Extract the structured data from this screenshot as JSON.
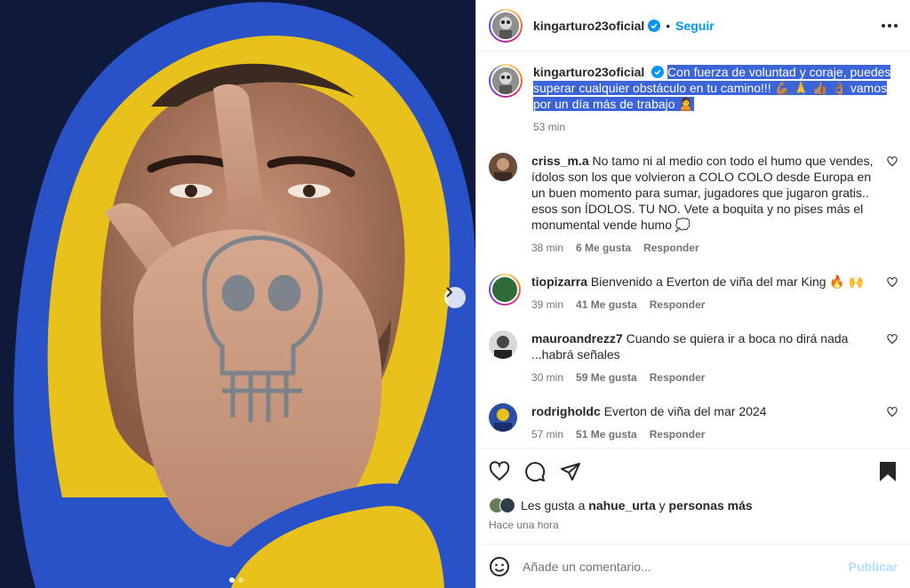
{
  "post": {
    "username": "kingarturo23oficial",
    "follow_label": "Seguir",
    "separator": "•",
    "caption": "Con fuerza de voluntad y coraje, puedes superar cualquier obstáculo en tu camino!!! 💪🏽 🙏 👍🏽 👌🏽 vamos por un día más de trabajo 🙎",
    "caption_time": "53 min"
  },
  "comments": [
    {
      "username": "criss_m.a",
      "text": "No tamo ni al medio con todo el humo que vendes, ídolos son los que volvieron a COLO COLO desde Europa en un buen momento para sumar, jugadores que jugaron gratis.. esos son ÍDOLOS. TU NO. Vete a boquita y no pises más el monumental vende humo 💭",
      "time": "38 min",
      "likes": "6 Me gusta",
      "reply": "Responder"
    },
    {
      "username": "tiopizarra",
      "text": "Bienvenido a Everton de viña del mar King 🔥 🙌",
      "time": "39 min",
      "likes": "41 Me gusta",
      "reply": "Responder"
    },
    {
      "username": "mauroandrezz7",
      "text": "Cuando se quiera ir a boca no dirá nada ...habrá señales",
      "time": "30 min",
      "likes": "59 Me gusta",
      "reply": "Responder"
    },
    {
      "username": "rodrigholdc",
      "text": "Everton de viña del mar 2024",
      "time": "57 min",
      "likes": "51 Me gusta",
      "reply": "Responder"
    }
  ],
  "likes": {
    "prefix": "Les gusta a",
    "user": "nahue_urta",
    "conj": "y",
    "others": "personas más"
  },
  "post_time": "Hace una hora",
  "add_comment": {
    "placeholder": "Añade un comentario...",
    "publish_label": "Publicar"
  },
  "carousel": {
    "count": 2,
    "active": 1
  },
  "icons": [
    "verified-badge-icon",
    "more-options-icon",
    "heart-icon",
    "comment-icon",
    "share-icon",
    "bookmark-icon",
    "emoji-icon",
    "chevron-right-icon"
  ],
  "colors": {
    "accent": "#0095f6",
    "highlight": "#3c64d9",
    "secondary_text": "#737373",
    "publish_disabled": "#b3dbff"
  }
}
